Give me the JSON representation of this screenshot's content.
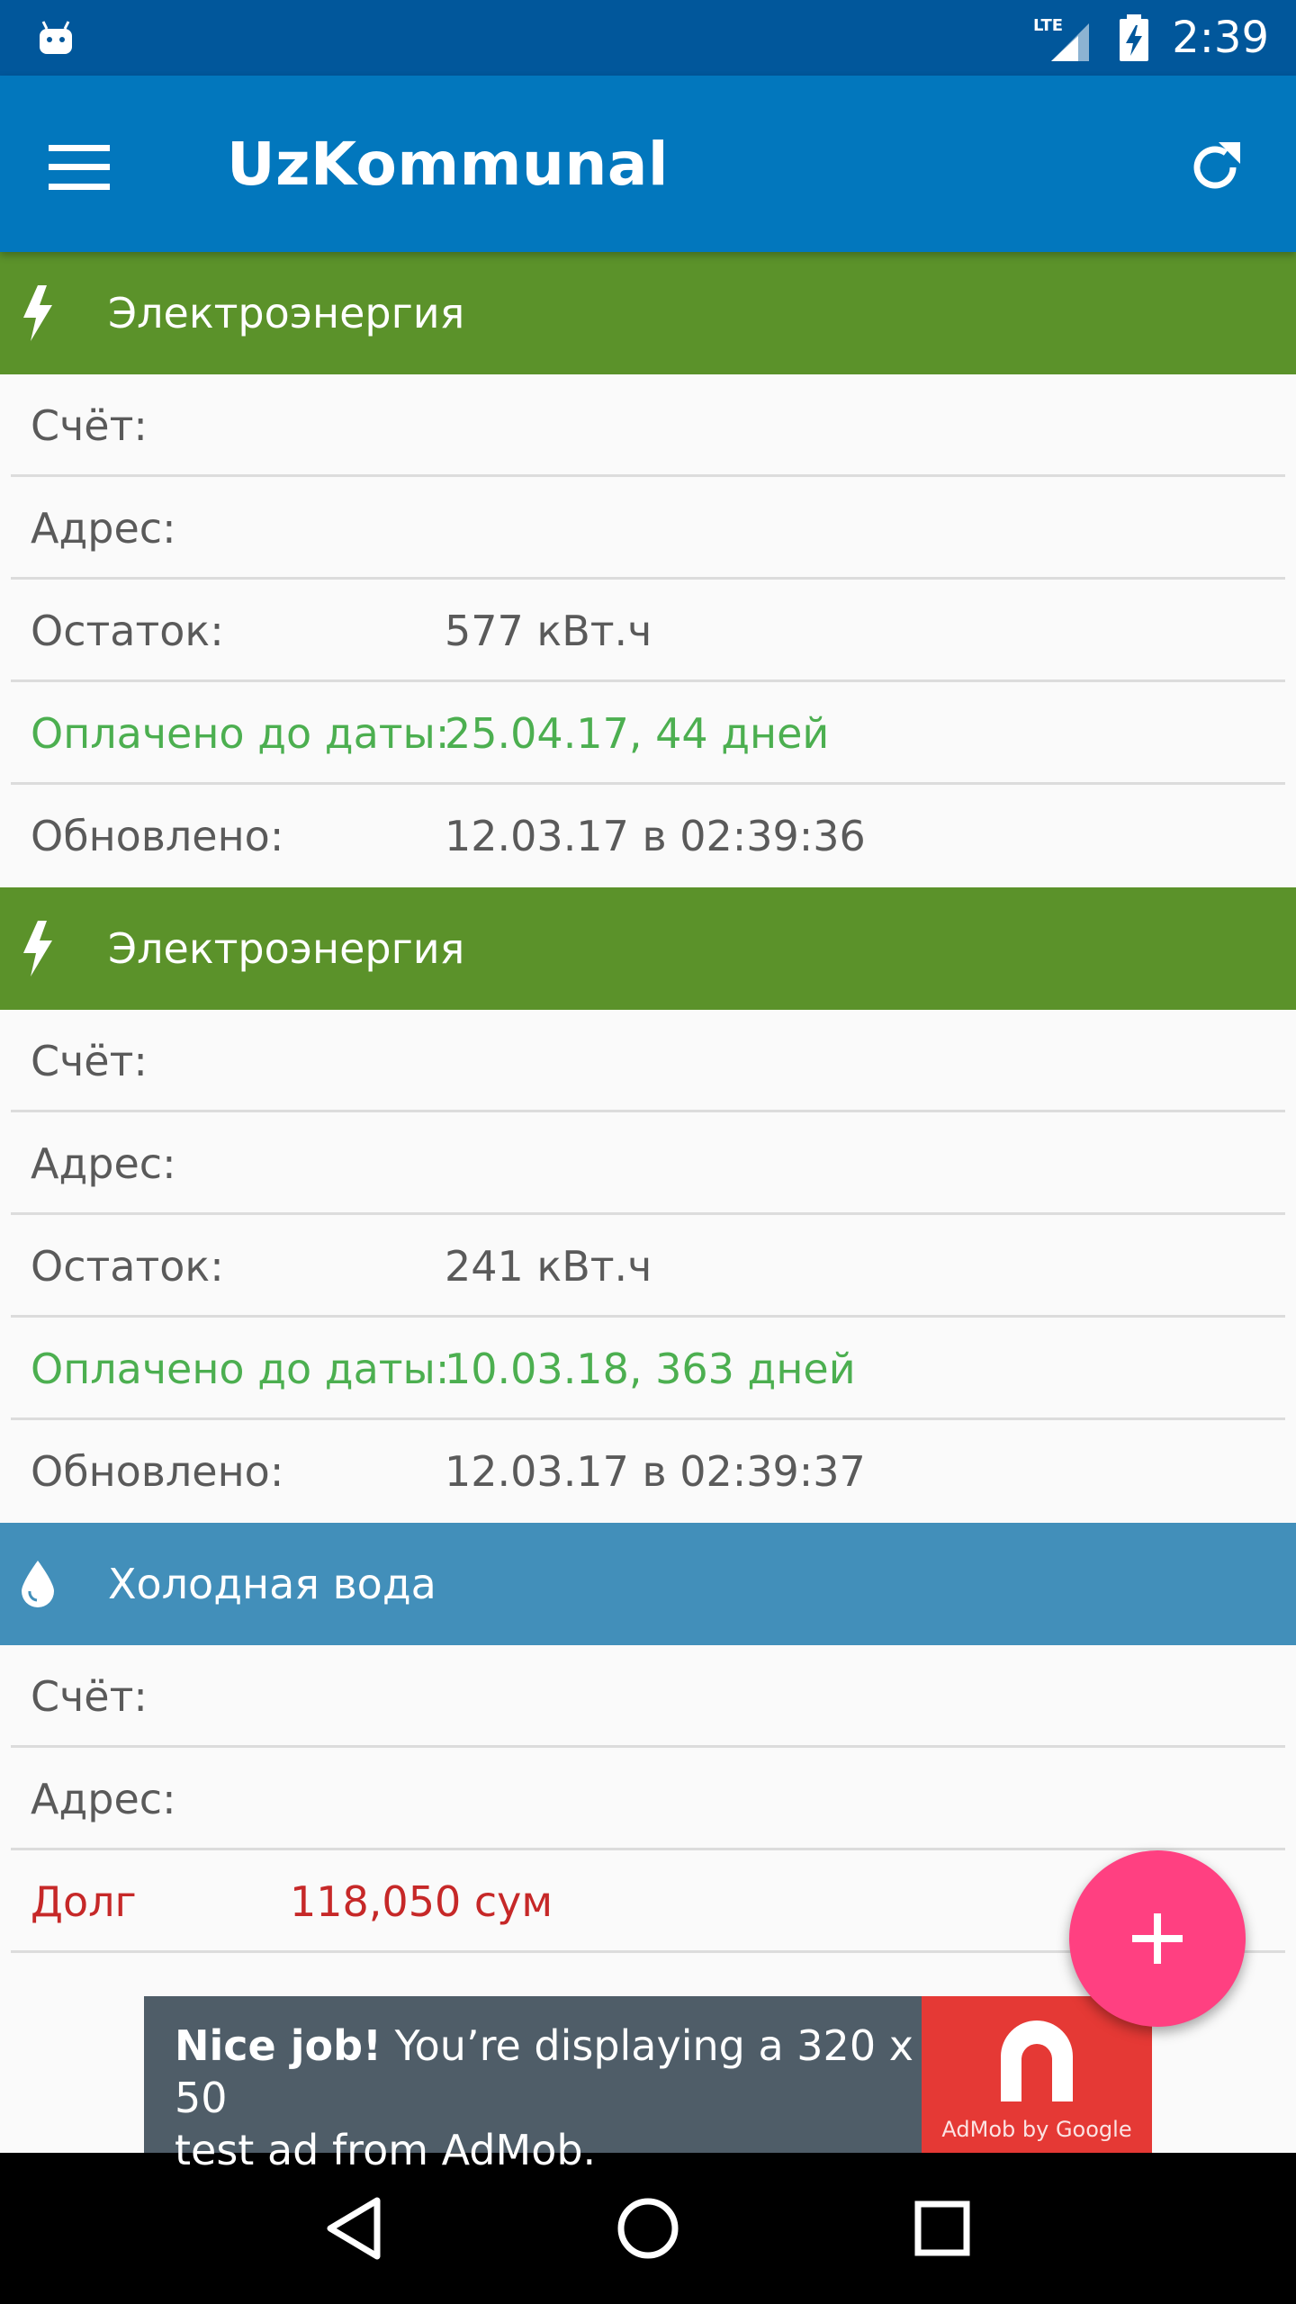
{
  "status_bar": {
    "network": "LTE",
    "time": "2:39"
  },
  "app_bar": {
    "title": "UzKommunal"
  },
  "sections": [
    {
      "type": "electricity",
      "title": "Электроэнергия",
      "rows": [
        {
          "label": "Счёт:",
          "value": ""
        },
        {
          "label": "Адрес:",
          "value": ""
        },
        {
          "label": "Остаток:",
          "value": "577 кВт.ч"
        },
        {
          "label": "Оплачено до даты:",
          "value": "25.04.17, 44 дней"
        },
        {
          "label": "Обновлено:",
          "value": "12.03.17 в 02:39:36"
        }
      ]
    },
    {
      "type": "electricity",
      "title": "Электроэнергия",
      "rows": [
        {
          "label": "Счёт:",
          "value": ""
        },
        {
          "label": "Адрес:",
          "value": ""
        },
        {
          "label": "Остаток:",
          "value": "241 кВт.ч"
        },
        {
          "label": "Оплачено до даты:",
          "value": "10.03.18, 363 дней"
        },
        {
          "label": "Обновлено:",
          "value": "12.03.17 в 02:39:37"
        }
      ]
    },
    {
      "type": "cold_water",
      "title": "Холодная вода",
      "rows": [
        {
          "label": "Счёт:",
          "value": ""
        },
        {
          "label": "Адрес:",
          "value": ""
        },
        {
          "label": "Долг",
          "value": "118,050 сум"
        }
      ]
    }
  ],
  "ad": {
    "headline": "Nice job!",
    "text_line1": " You’re displaying a 320 x 50",
    "text_line2": "test ad from AdMob.",
    "logo_caption": "AdMob by Google"
  },
  "colors": {
    "status_bar": "#01579b",
    "app_bar": "#0277bd",
    "electricity_header": "#5b922a",
    "water_header": "#428fba",
    "paid_green": "#4caf50",
    "debt_red": "#c62828",
    "fab": "#ff4081"
  },
  "icons": {
    "status": [
      "android-icon",
      "lte-signal-icon",
      "battery-charging-icon"
    ],
    "app_bar": [
      "menu-icon",
      "refresh-icon"
    ],
    "sections": [
      "lightning-icon",
      "lightning-icon",
      "water-drop-icon"
    ],
    "fab": "plus-icon",
    "nav": [
      "back-icon",
      "home-icon",
      "recents-icon"
    ]
  }
}
